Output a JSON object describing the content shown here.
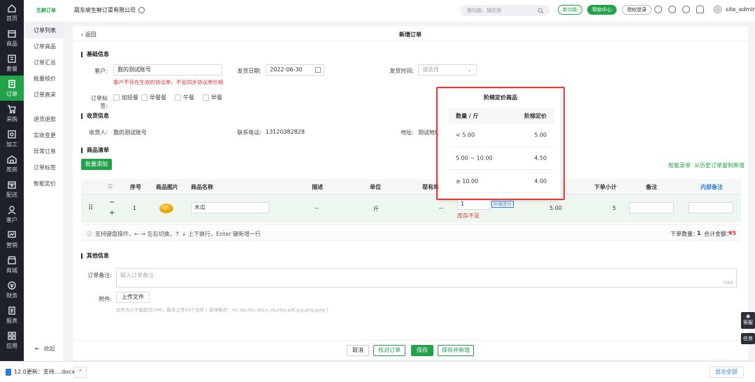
{
  "rail": [
    {
      "label": "首页",
      "icon": "home-icon"
    },
    {
      "label": "商品",
      "icon": "box-icon"
    },
    {
      "label": "套餐",
      "icon": "package-icon"
    },
    {
      "label": "订单",
      "icon": "order-icon",
      "active": true
    },
    {
      "label": "采购",
      "icon": "cart-icon"
    },
    {
      "label": "加工",
      "icon": "process-icon"
    },
    {
      "label": "库房",
      "icon": "warehouse-icon"
    },
    {
      "label": "配送",
      "icon": "delivery-icon"
    },
    {
      "label": "客户",
      "icon": "customer-icon"
    },
    {
      "label": "营销",
      "icon": "marketing-icon"
    },
    {
      "label": "商城",
      "icon": "shop-icon"
    },
    {
      "label": "财务",
      "icon": "finance-icon"
    },
    {
      "label": "报表",
      "icon": "report-icon"
    },
    {
      "label": "应用",
      "icon": "apps-icon"
    }
  ],
  "sidebar": {
    "group1": [
      "订单列表",
      "订单商品",
      "订单汇总",
      "批量核价",
      "订单直采"
    ],
    "group2": [
      "退货退款",
      "实收变更",
      "异常订单",
      "订单标签",
      "智能定价"
    ],
    "collapse": "收起"
  },
  "header": {
    "logo": "生鲜订单",
    "company": "蔬东坡生鲜订菜有限公司",
    "search_placeholder": "搜功能、搜应用",
    "new_feature": "新功能",
    "help_center": "帮助中心",
    "auth_login": "授权登录",
    "username": "site_admin"
  },
  "page": {
    "back": "返回",
    "title": "新增订单"
  },
  "basic": {
    "section": "基础信息",
    "customer_label": "客户:",
    "customer_value": "我的测试账号",
    "warning": "客户不存在生效的协议单，不会同步协议单价格",
    "date_label": "发货日期:",
    "date_value": "2022-06-30",
    "time_label": "发货时间:",
    "time_placeholder": "请选择",
    "tags_label": "订单标签:",
    "tags": [
      "加班餐",
      "早餐餐",
      "午餐",
      "早餐"
    ]
  },
  "receiver": {
    "section": "收货信息",
    "name_label": "收货人:",
    "name_value": "我的测试账号",
    "phone_label": "联系电话:",
    "phone_value": "13120382828",
    "addr_label": "地址:",
    "addr_value": "测试地址"
  },
  "goods": {
    "section": "商品清单",
    "bulk_add": "批量添加",
    "smart_entry": "智能录单",
    "copy_history": "从历史订单复制新增",
    "columns": {
      "index": "序号",
      "image": "商品图片",
      "name": "商品名称",
      "desc": "描述",
      "unit": "单位",
      "stock": "现有库存",
      "subtotal": "下单小计",
      "remark": "备注",
      "inner_remark": "内部备注"
    },
    "row": {
      "index": "1",
      "name": "木瓜",
      "desc": "--",
      "unit": "斤",
      "stock": "--",
      "qty": "1",
      "tag": "阶梯定价",
      "stock_warn": "库存不足",
      "price": "5.00",
      "subtotal": "5"
    },
    "tip": "支持键盘操作，← → 左右切换，↑ ↓ 上下换行，Enter 键新增一行",
    "total_qty_label": "下单数量：",
    "total_qty": "1",
    "total_amount_label": "合计金额：",
    "total_amount": "¥5"
  },
  "other": {
    "section": "其他信息",
    "remark_label": "订单备注:",
    "remark_placeholder": "输入订单备注",
    "remark_count": "0/64",
    "attach_label": "附件:",
    "upload": "上传文件",
    "upload_note": "文件大小不能超过10M，最多上传10个文件 ( 支持格式：rar,zip,doc,docx,xls,xlsx,pdf,jpg,png,jpeg )"
  },
  "actions": {
    "cancel": "取消",
    "verify": "核对订单",
    "save": "保存",
    "save_new": "保存并新增"
  },
  "popover": {
    "title": "阶梯定价商品",
    "col_qty": "数量 / 斤",
    "col_price": "阶梯定价",
    "rows": [
      {
        "range": "< 5.00",
        "price": "5.00"
      },
      {
        "range": "5.00 ~ 10.00",
        "price": "4.50"
      },
      {
        "range": "≥ 10.00",
        "price": "4.00"
      }
    ]
  },
  "floating": {
    "service": "客服",
    "task": "任务"
  },
  "download": {
    "file": "12.0更新：支持....docx",
    "show_all": "显示全部"
  },
  "colors": {
    "accent": "#22a34a",
    "rail": "#1e2129",
    "danger": "#e53935",
    "link": "#2f7de1"
  }
}
